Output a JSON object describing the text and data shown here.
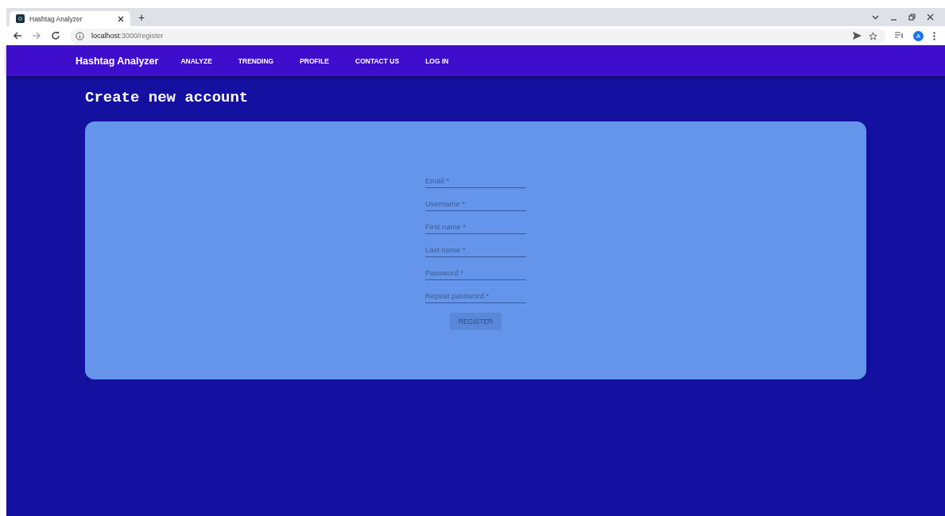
{
  "browser": {
    "tab_title": "Hashtag Analyzer",
    "new_tab": "+",
    "url_host": "localhost",
    "url_path": ":3000/register",
    "avatar": "A"
  },
  "navbar": {
    "brand": "Hashtag Analyzer",
    "links": [
      {
        "label": "ANALYZE"
      },
      {
        "label": "TRENDING"
      },
      {
        "label": "PROFILE"
      },
      {
        "label": "CONTACT US"
      },
      {
        "label": "LOG IN"
      }
    ]
  },
  "page_title": "Create new account",
  "form": {
    "fields": [
      {
        "placeholder": "Email *"
      },
      {
        "placeholder": "Username *"
      },
      {
        "placeholder": "First name *"
      },
      {
        "placeholder": "Last name *"
      },
      {
        "placeholder": "Password *"
      },
      {
        "placeholder": "Repeat password *"
      }
    ],
    "submit": {
      "label": "REGISTER",
      "disabled": true
    }
  }
}
